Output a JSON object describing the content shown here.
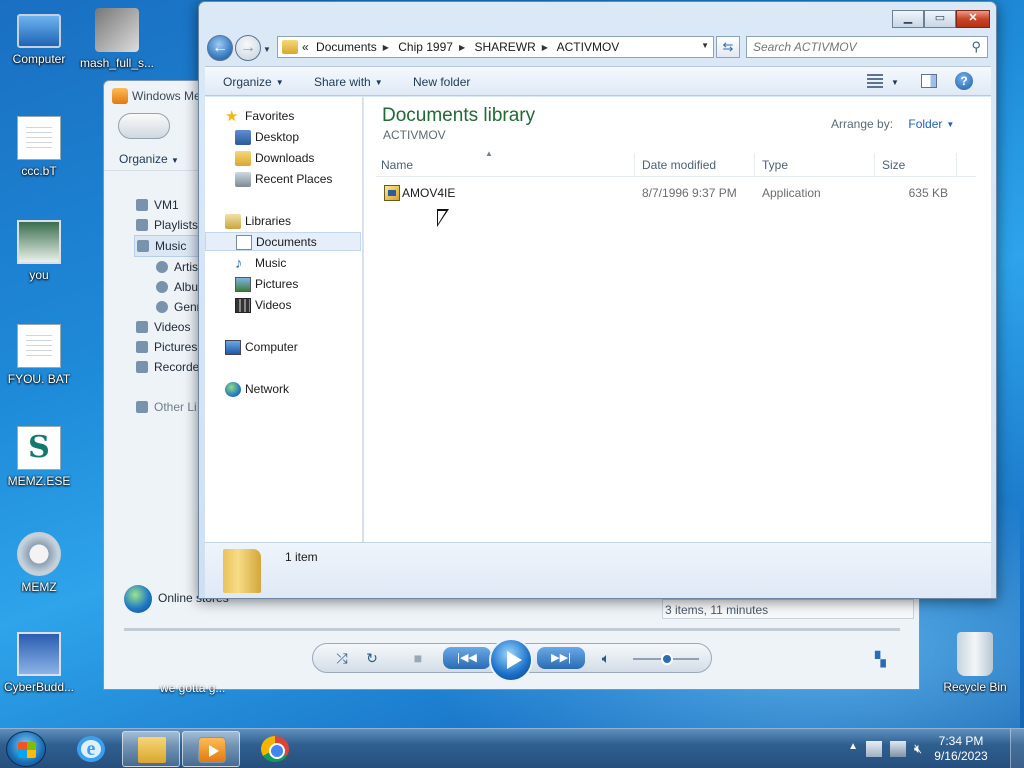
{
  "desktop": {
    "icons": [
      {
        "label": "Computer",
        "icon": "computer-icon"
      },
      {
        "label": "mash_full_s...",
        "icon": "installer-icon"
      },
      {
        "label": "ccc.bT",
        "icon": "document-icon"
      },
      {
        "label": "you",
        "icon": "image-file-icon"
      },
      {
        "label": "FYOU. BAT",
        "icon": "document-icon"
      },
      {
        "label": "MEMZ.ESE",
        "icon": "memz-icon"
      },
      {
        "label": "MEMZ",
        "icon": "gear-icon"
      },
      {
        "label": "CyberBudd...",
        "icon": "app-icon"
      },
      {
        "label": "Recycle Bin",
        "icon": "recycle-bin-icon"
      }
    ]
  },
  "media_player": {
    "title": "Windows Me",
    "organize": "Organize",
    "nav": [
      "VM1",
      "Playlists",
      "Music",
      "Artis",
      "Albu",
      "Genr",
      "Videos",
      "Pictures",
      "Recorde",
      "Other Li"
    ],
    "selected_nav": "Music",
    "online_stores": "Online stores",
    "status": "3 items, 11 minutes",
    "under_caption": "we gotta g..."
  },
  "explorer": {
    "window_buttons": {
      "minimize": "▁",
      "maximize": "▭",
      "close": "✕"
    },
    "address": {
      "prefix": "«",
      "crumbs": [
        "Documents",
        "Chip 1997",
        "SHAREWR",
        "ACTIVMOV"
      ]
    },
    "search": {
      "placeholder": "Search ACTIVMOV"
    },
    "toolbar": {
      "organize": "Organize",
      "share_with": "Share with",
      "new_folder": "New folder"
    },
    "nav": {
      "favorites": "Favorites",
      "desktop": "Desktop",
      "downloads": "Downloads",
      "recent_places": "Recent Places",
      "libraries": "Libraries",
      "documents": "Documents",
      "music": "Music",
      "pictures": "Pictures",
      "videos": "Videos",
      "computer": "Computer",
      "network": "Network"
    },
    "content": {
      "title": "Documents library",
      "subtitle": "ACTIVMOV",
      "arrange_label": "Arrange by:",
      "arrange_value": "Folder",
      "columns": {
        "name": "Name",
        "date": "Date modified",
        "type": "Type",
        "size": "Size"
      },
      "files": [
        {
          "name": "AMOV4IE",
          "date": "8/7/1996 9:37 PM",
          "type": "Application",
          "size": "635 KB"
        }
      ]
    },
    "details": {
      "count": "1 item"
    }
  },
  "taskbar": {
    "clock_time": "7:34 PM",
    "clock_date": "9/16/2023"
  },
  "colors": {
    "library_title": "#1e6b34",
    "link_blue": "#1e62b9",
    "close_red": "#c7452a"
  }
}
